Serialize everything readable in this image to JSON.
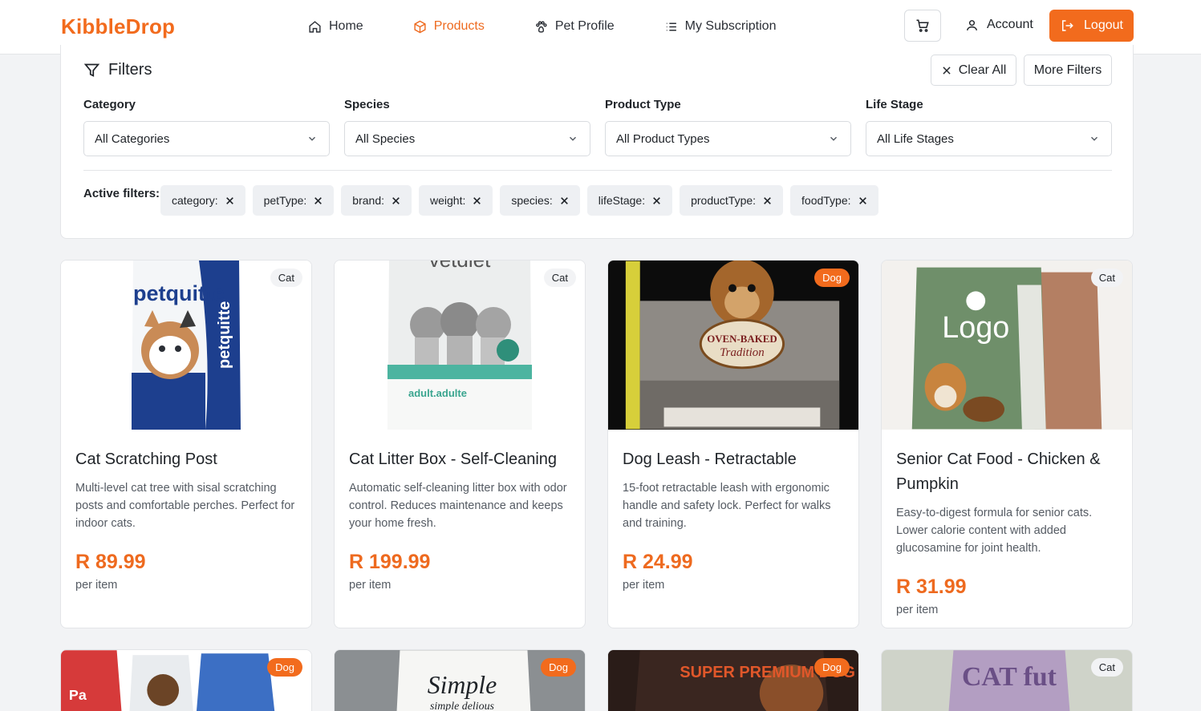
{
  "brand": "KibbleDrop",
  "nav": {
    "home": "Home",
    "products": "Products",
    "pet_profile": "Pet Profile",
    "subscription": "My Subscription"
  },
  "header": {
    "account": "Account",
    "logout": "Logout"
  },
  "filters": {
    "title": "Filters",
    "clear_all": "Clear All",
    "more_filters": "More Filters",
    "category": {
      "label": "Category",
      "value": "All Categories"
    },
    "species": {
      "label": "Species",
      "value": "All Species"
    },
    "product_type": {
      "label": "Product Type",
      "value": "All Product Types"
    },
    "life_stage": {
      "label": "Life Stage",
      "value": "All Life Stages"
    },
    "active_label": "Active filters:",
    "chips": [
      "category:",
      "petType:",
      "brand:",
      "weight:",
      "species:",
      "lifeStage:",
      "productType:",
      "foodType:"
    ]
  },
  "products": [
    {
      "badge": "Cat",
      "title": "Cat Scratching Post",
      "description": "Multi-level cat tree with sisal scratching posts and comfortable perches. Perfect for indoor cats.",
      "price": "R 89.99",
      "unit": "per item",
      "image_text": "petquitte"
    },
    {
      "badge": "Cat",
      "title": "Cat Litter Box - Self-Cleaning",
      "description": "Automatic self-cleaning litter box with odor control. Reduces maintenance and keeps your home fresh.",
      "price": "R 199.99",
      "unit": "per item",
      "image_text": "vetdiet",
      "image_text_2": "adult.adulte"
    },
    {
      "badge": "Dog",
      "title": "Dog Leash - Retractable",
      "description": "15-foot retractable leash with ergonomic handle and safety lock. Perfect for walks and training.",
      "price": "R 24.99",
      "unit": "per item",
      "image_text": "OVEN-BAKED",
      "image_text_2": "Tradition"
    },
    {
      "badge": "Cat",
      "title": "Senior Cat Food - Chicken & Pumpkin",
      "description": "Easy-to-digest formula for senior cats. Lower calorie content with added glucosamine for joint health.",
      "price": "R 31.99",
      "unit": "per item",
      "image_text": "Logo"
    }
  ],
  "products_row2": [
    {
      "badge": "Dog",
      "image_text": "Pa"
    },
    {
      "badge": "Dog",
      "image_text": "Simple",
      "image_text_2": "simple delious"
    },
    {
      "badge": "Dog",
      "image_text": "SUPER PREMIUM DOG FOOD"
    },
    {
      "badge": "Cat",
      "image_text": "CAT fut"
    }
  ]
}
